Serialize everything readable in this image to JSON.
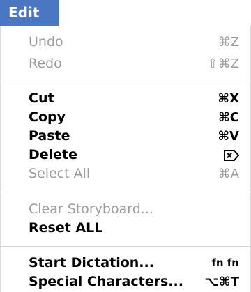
{
  "menu": {
    "title": "Edit",
    "accent_color": "#4a76c2",
    "groups": [
      {
        "items": [
          {
            "label": "Undo",
            "shortcut": "⌘Z",
            "enabled": false
          },
          {
            "label": "Redo",
            "shortcut": "⇧⌘Z",
            "enabled": false
          }
        ]
      },
      {
        "items": [
          {
            "label": "Cut",
            "shortcut": "⌘X",
            "enabled": true
          },
          {
            "label": "Copy",
            "shortcut": "⌘C",
            "enabled": true
          },
          {
            "label": "Paste",
            "shortcut": "⌘V",
            "enabled": true
          },
          {
            "label": "Delete",
            "shortcut_icon": "delete-forward-icon",
            "enabled": true
          },
          {
            "label": "Select All",
            "shortcut": "⌘A",
            "enabled": false
          }
        ]
      },
      {
        "items": [
          {
            "label": "Clear Storyboard...",
            "enabled": false
          },
          {
            "label": "Reset ALL",
            "enabled": true
          }
        ]
      },
      {
        "items": [
          {
            "label": "Start Dictation...",
            "shortcut": "fn fn",
            "enabled": true
          },
          {
            "label": "Special Characters...",
            "shortcut": "⌥⌘T",
            "enabled": true
          }
        ]
      }
    ]
  }
}
